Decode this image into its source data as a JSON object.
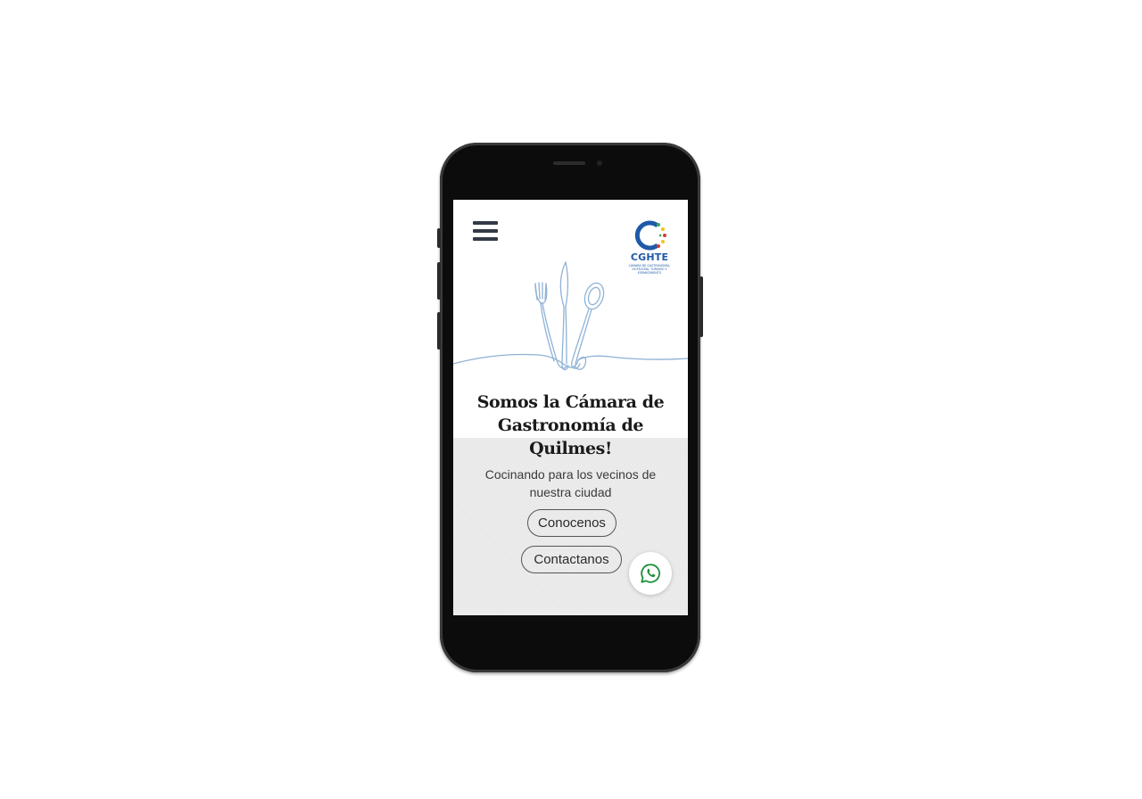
{
  "header": {
    "menu_icon": "hamburger-menu-icon",
    "logo": {
      "text": "CGHTE",
      "subtitle": "CÁMARA DE GASTRONOMÍA, HOTELERÍA, TURISMO Y ESPARCIMIENTO",
      "colors": {
        "ring": "#1e5aa8",
        "accent_green": "#3aa655",
        "accent_yellow": "#f2c31b",
        "accent_red": "#d73b2f"
      }
    }
  },
  "hero": {
    "illustration": "cutlery-line-art",
    "title": "Somos la Cámara de Gastronomía de Quilmes!",
    "subtitle": "Cocinando para los vecinos de nuestra ciudad",
    "buttons": {
      "primary": "Conocenos",
      "secondary": "Contactanos"
    }
  },
  "whatsapp": {
    "icon": "whatsapp-icon",
    "color": "#1d8f3a"
  },
  "theme": {
    "illustration_stroke": "#8fb2d6",
    "lower_background": "#ececec"
  }
}
